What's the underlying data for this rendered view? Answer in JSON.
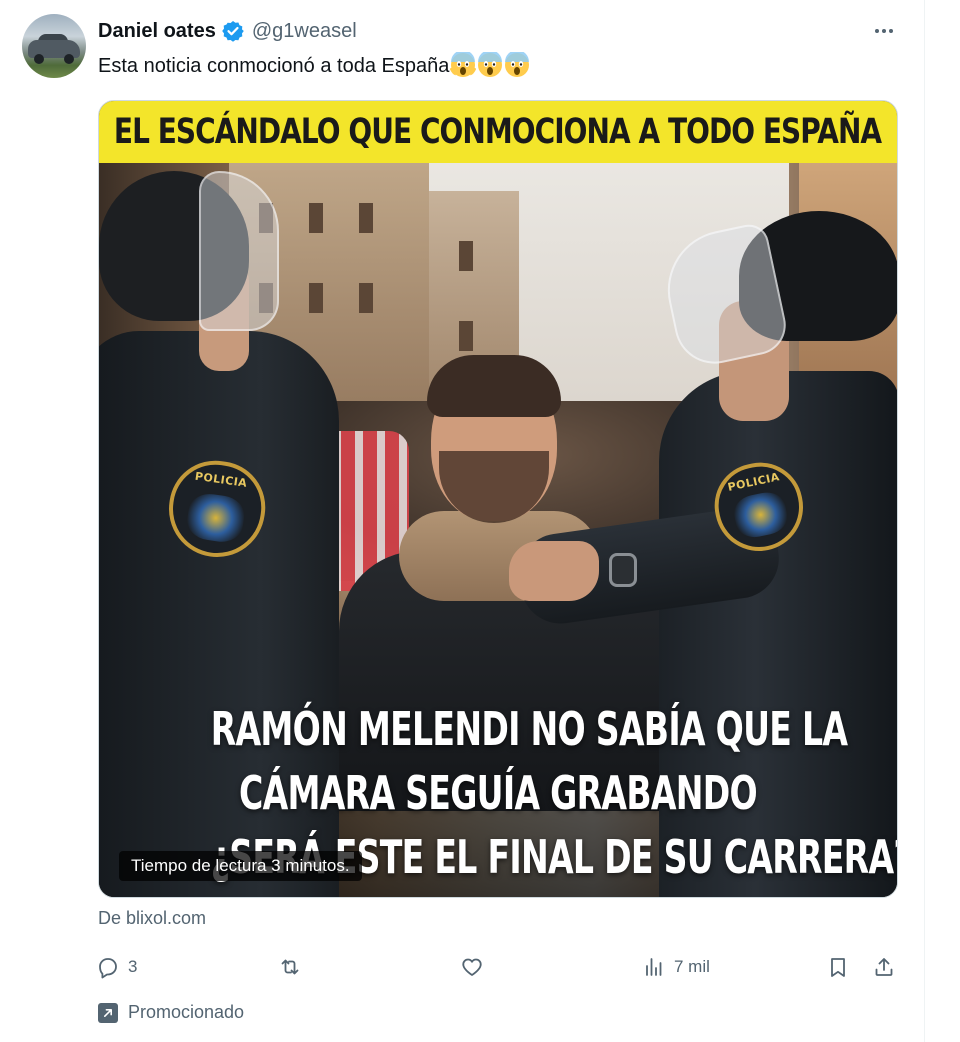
{
  "tweet": {
    "display_name": "Daniel oates",
    "handle": "@g1weasel",
    "text": "Esta noticia conmocionó a toda España",
    "emojis": [
      "scream-face",
      "scream-face",
      "scream-face"
    ],
    "verified": true,
    "verified_color": "#1d9bf0"
  },
  "card": {
    "banner_text": "EL ESCÁNDALO QUE CONMOCIONA A TODO ESPAÑA",
    "headline_lines": [
      "RAMÓN MELENDI NO SABÍA QUE LA",
      "CÁMARA SEGUÍA GRABANDO",
      "¿SERÁ ESTE EL FINAL DE SU CARRERA?"
    ],
    "patch_text": "POLICIA",
    "read_time_badge": "Tiempo de lectura 3 minutos.",
    "banner_color": "#f3e52a"
  },
  "source": "De blixol.com",
  "actions": {
    "reply_count": "3",
    "retweet_count": "",
    "like_count": "",
    "views_count": "7 mil"
  },
  "promoted_label": "Promocionado",
  "icons": {
    "more": "more-icon",
    "reply": "reply-icon",
    "retweet": "retweet-icon",
    "like": "like-icon",
    "views": "views-icon",
    "bookmark": "bookmark-icon",
    "share": "share-icon",
    "promoted": "promoted-arrow-icon"
  }
}
